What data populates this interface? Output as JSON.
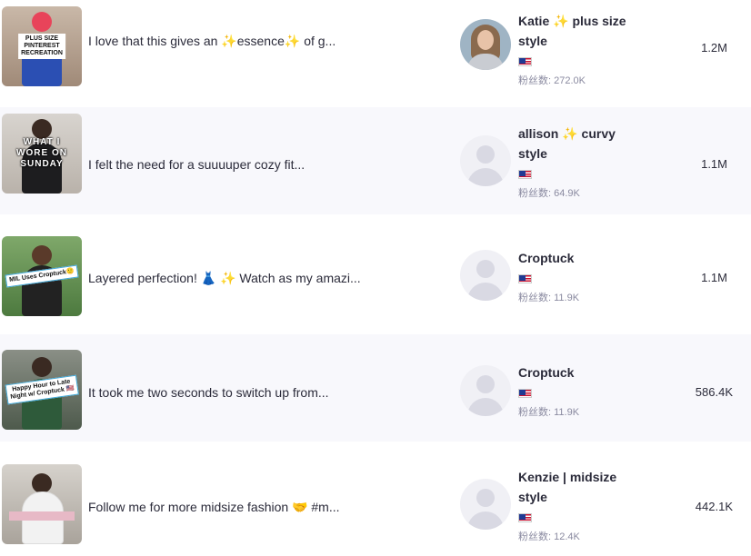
{
  "followers_prefix": "粉丝数: ",
  "rows": [
    {
      "title": "I love that this gives an ✨essence✨ of g...",
      "thumb_caption": "PLUS SIZE\nPINTEREST\nRECREATION",
      "creator_name": "Katie ✨ plus size style",
      "country": "US",
      "followers": "272.0K",
      "metric": "1.2M"
    },
    {
      "title": "I felt the need for a suuuuper cozy fit...",
      "thumb_caption": "WHAT I\nWORE ON\nSUNDAY",
      "creator_name": "allison ✨ curvy style",
      "country": "US",
      "followers": "64.9K",
      "metric": "1.1M"
    },
    {
      "title": "Layered perfection! 👗 ✨ Watch as my amazi...",
      "thumb_caption": "MIL Uses Croptuck🙂",
      "creator_name": "Croptuck",
      "country": "US",
      "followers": "11.9K",
      "metric": "1.1M"
    },
    {
      "title": "It took me two seconds to switch up from...",
      "thumb_caption": "Happy Hour to Late\nNight w/ Croptuck 🇺🇸",
      "creator_name": "Croptuck",
      "country": "US",
      "followers": "11.9K",
      "metric": "586.4K"
    },
    {
      "title": "Follow me for more midsize fashion 🤝 #m...",
      "thumb_caption": "",
      "creator_name": "Kenzie | midsize style",
      "country": "US",
      "followers": "12.4K",
      "metric": "442.1K"
    }
  ],
  "colors": {
    "alt_row_bg": "#f8f8fc",
    "text": "#2b2b3a",
    "muted": "#8a8aa0",
    "avatar_placeholder": "#d9d9e3"
  }
}
